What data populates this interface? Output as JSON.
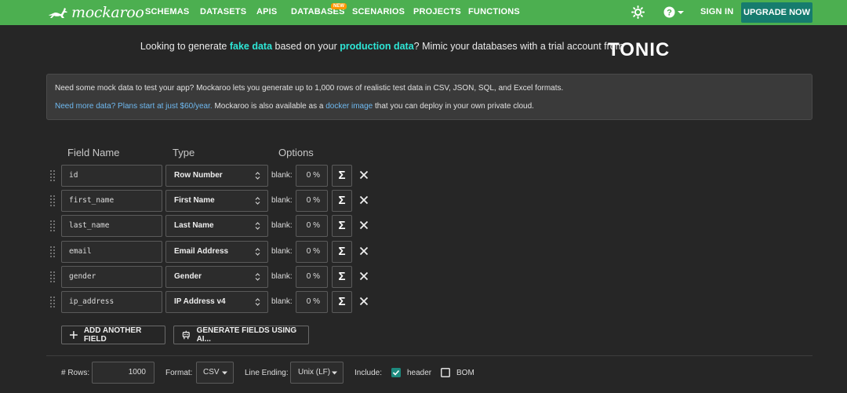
{
  "nav": {
    "logo_text": "mockaroo",
    "links": [
      "SCHEMAS",
      "DATASETS",
      "APIS",
      "DATABASES",
      "SCENARIOS",
      "PROJECTS",
      "FUNCTIONS"
    ],
    "new_badge": "NEW",
    "sign_in": "SIGN IN",
    "upgrade": "UPGRADE NOW"
  },
  "promo": {
    "p1": "Looking to generate ",
    "h1": "fake data",
    "p2": " based on your ",
    "h2": "production data",
    "p3": "? Mimic your databases with a trial account from",
    "brand": "TONIC"
  },
  "info": {
    "line1": "Need some mock data to test your app? Mockaroo lets you generate up to 1,000 rows of realistic test data in CSV, JSON, SQL, and Excel formats.",
    "line2_link": "Need more data? Plans start at just $60/year.",
    "line2_text": " Mockaroo is also available as a ",
    "line2_link2": "docker image",
    "line2_end": " that you can deploy in your own private cloud."
  },
  "headers": {
    "field_name": "Field Name",
    "type": "Type",
    "options": "Options"
  },
  "fields": [
    {
      "name": "id",
      "type": "Row Number",
      "blank_label": "blank:",
      "blank": "0 %"
    },
    {
      "name": "first_name",
      "type": "First Name",
      "blank_label": "blank:",
      "blank": "0 %"
    },
    {
      "name": "last_name",
      "type": "Last Name",
      "blank_label": "blank:",
      "blank": "0 %"
    },
    {
      "name": "email",
      "type": "Email Address",
      "blank_label": "blank:",
      "blank": "0 %"
    },
    {
      "name": "gender",
      "type": "Gender",
      "blank_label": "blank:",
      "blank": "0 %"
    },
    {
      "name": "ip_address",
      "type": "IP Address v4",
      "blank_label": "blank:",
      "blank": "0 %"
    }
  ],
  "sigma_symbol": "Σ",
  "buttons": {
    "add_field": "ADD ANOTHER FIELD",
    "generate_ai": "GENERATE FIELDS USING AI..."
  },
  "bottom": {
    "rows_label": "# Rows:",
    "rows_value": "1000",
    "format_label": "Format:",
    "format_value": "CSV",
    "line_ending_label": "Line Ending:",
    "line_ending_value": "Unix (LF)",
    "include_label": "Include:",
    "header_label": "header",
    "header_checked": true,
    "bom_label": "BOM",
    "bom_checked": false
  },
  "colors": {
    "nav_green": "#4caf50",
    "accent_teal": "#2ee6d6",
    "upgrade_bg": "#167c6e",
    "link_blue": "#6fb9f0"
  }
}
